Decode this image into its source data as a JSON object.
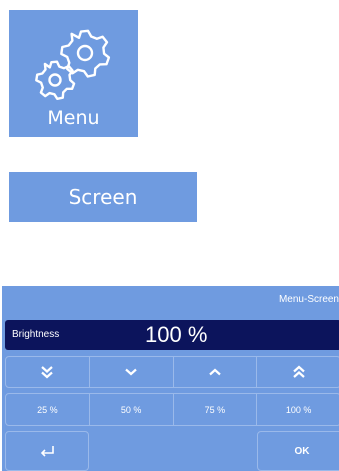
{
  "menu_tile": {
    "label": "Menu",
    "icon": "gears-icon"
  },
  "screen_button": {
    "label": "Screen"
  },
  "panel": {
    "title": "Menu-Screen",
    "brightness": {
      "label": "Brightness",
      "value": "100 %"
    },
    "arrow_buttons": [
      {
        "icon": "double-chevron-down-icon"
      },
      {
        "icon": "chevron-down-icon"
      },
      {
        "icon": "chevron-up-icon"
      },
      {
        "icon": "double-chevron-up-icon"
      }
    ],
    "presets": [
      "25 %",
      "50 %",
      "75 %",
      "100 %"
    ],
    "back_icon": "return-arrow-icon",
    "ok_label": "OK"
  },
  "colors": {
    "tile_blue": "#6f9be0",
    "dark_navy": "#0c145c",
    "button_border": "#9ab9ea",
    "text_white": "#ffffff"
  }
}
